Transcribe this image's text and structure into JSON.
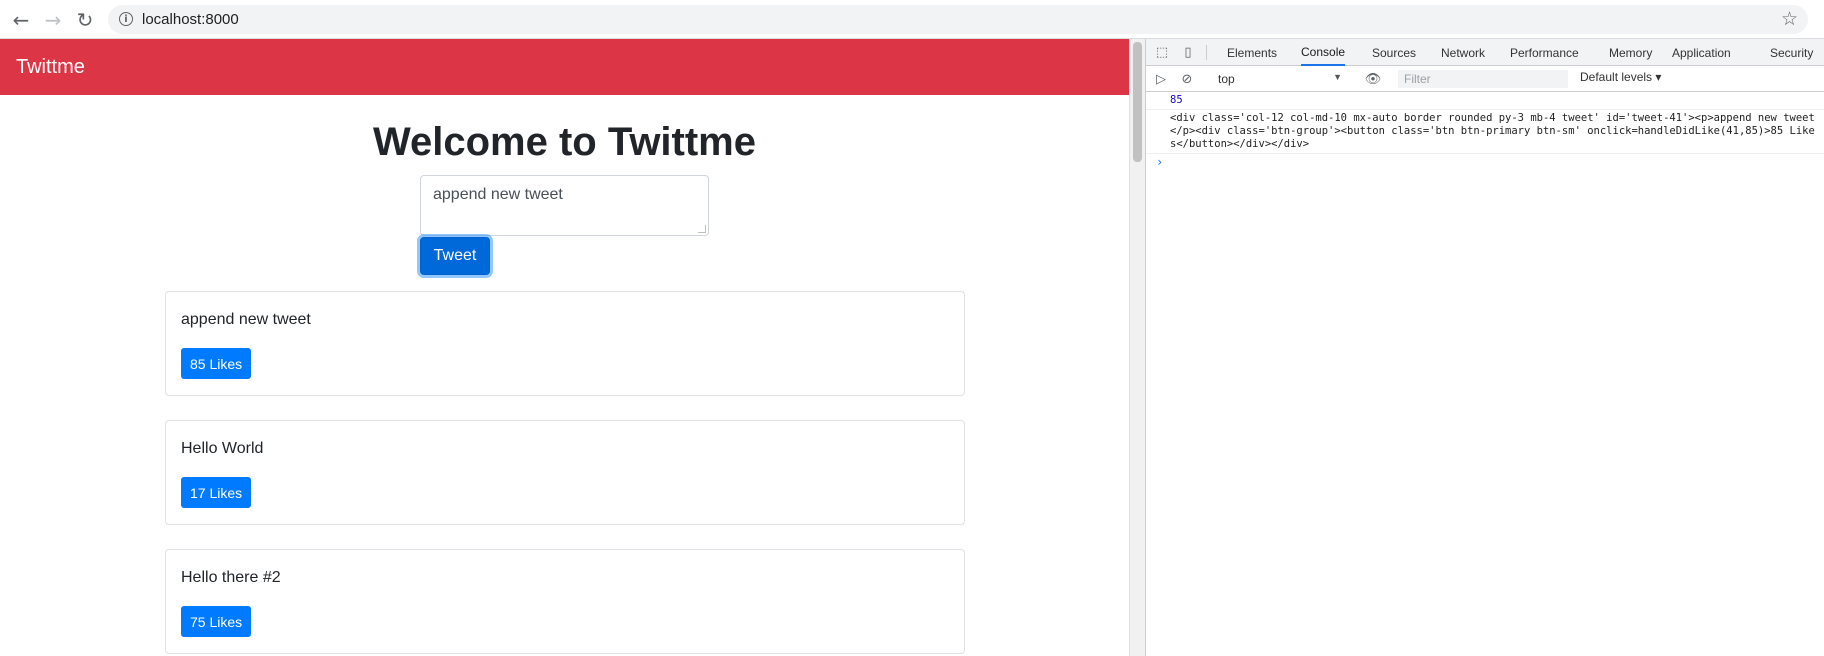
{
  "browser": {
    "url": "localhost:8000",
    "back_icon": "arrow-left",
    "forward_icon": "arrow-right",
    "reload_icon": "reload",
    "info_icon": "info",
    "star_icon": "star"
  },
  "app": {
    "brand": "Twittme",
    "heading": "Welcome to Twittme",
    "input_value": "append new tweet",
    "tweet_button": "Tweet",
    "colors": {
      "navbar": "#dc3545",
      "primary": "#007bff"
    }
  },
  "tweets": [
    {
      "text": "append new tweet",
      "likes": "85 Likes"
    },
    {
      "text": "Hello World",
      "likes": "17 Likes"
    },
    {
      "text": "Hello there #2",
      "likes": "75 Likes"
    }
  ],
  "devtools": {
    "tabs": [
      "Elements",
      "Console",
      "Sources",
      "Network",
      "Performance",
      "Memory",
      "Application",
      "Security"
    ],
    "active_tab": "Console",
    "context": "top",
    "filter_placeholder": "Filter",
    "levels": "Default levels",
    "console_lines": [
      "85",
      "<div class='col-12 col-md-10 mx-auto border rounded py-3 mb-4 tweet' id='tweet-41'><p>append new tweet</p><div class='btn-group'><button class='btn btn-primary btn-sm' onclick=handleDidLike(41,85)>85 Likes</button></div></div>"
    ],
    "prompt": "›"
  }
}
